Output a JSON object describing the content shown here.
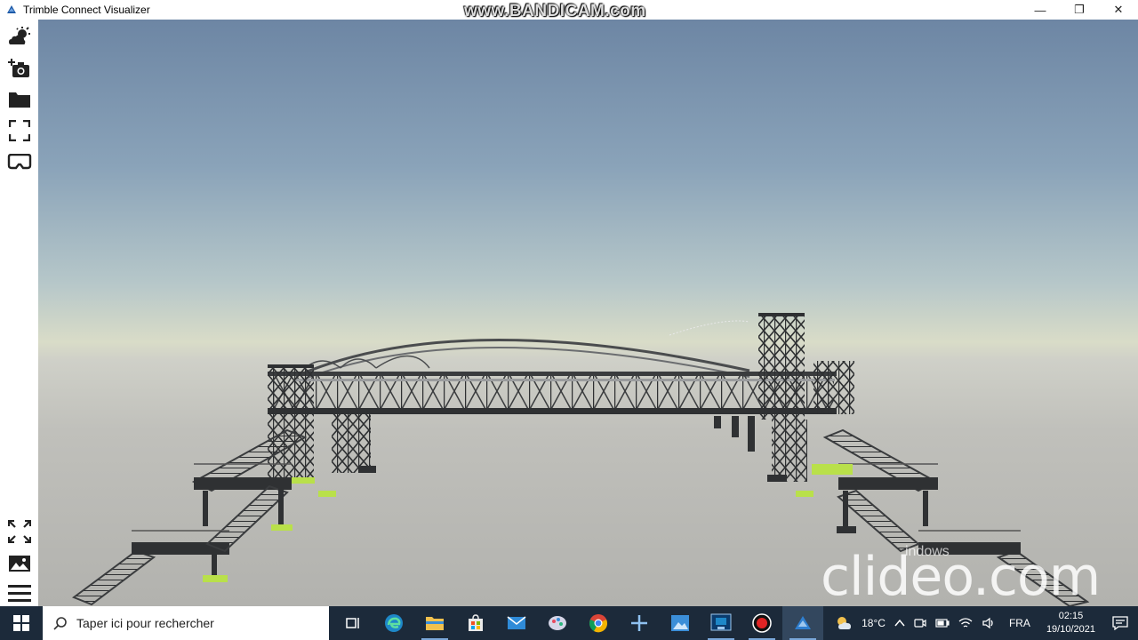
{
  "window": {
    "title": "Trimble Connect Visualizer",
    "minimize": "—",
    "restore": "❐",
    "close": "✕"
  },
  "watermarks": {
    "top": "www.BANDICAM.com",
    "bottom": "clideo.com",
    "activation": "indows"
  },
  "toolbar": {
    "top_tools": [
      "weather-sun-cloud-icon",
      "add-camera-icon",
      "folder-icon",
      "fullscreen-frame-icon",
      "vr-headset-icon"
    ],
    "bottom_tools": [
      "expand-arrows-icon",
      "image-icon",
      "menu-icon"
    ]
  },
  "taskbar": {
    "search_placeholder": "Taper ici pour rechercher",
    "apps": [
      "task-view-icon",
      "edge-icon",
      "file-explorer-icon",
      "store-icon",
      "mail-icon",
      "paint-icon",
      "chrome-icon",
      "snip-icon",
      "photos-icon",
      "visual-app-icon",
      "record-icon",
      "trimble-icon"
    ],
    "weather": "18°C",
    "language": "FRA",
    "time": "02:15",
    "date": "19/10/2021"
  },
  "colors": {
    "taskbar": "#1c2a3a",
    "steel": "#3b3d3f",
    "pad": "#b9e04a"
  }
}
